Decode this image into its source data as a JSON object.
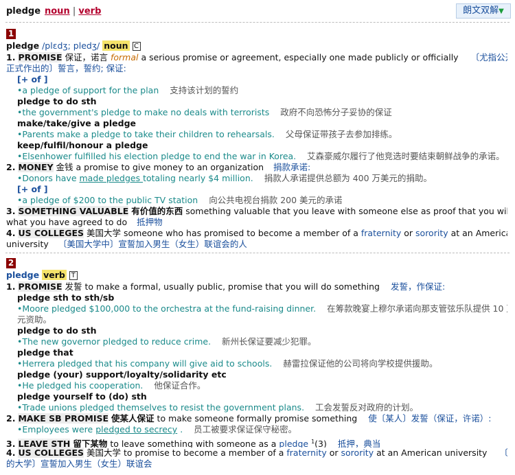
{
  "header": {
    "headword": "pledge",
    "pos_links": [
      "noun",
      "verb"
    ],
    "separator": "|",
    "longman_button": "朗文双解",
    "dropdown_glyph": "▼"
  },
  "entries": [
    {
      "number": "1",
      "headword": "pledge",
      "pron": "/plɛdʒ; pledʒ/",
      "pos": "noun",
      "gram_code": "C",
      "senses": [
        {
          "n": "1.",
          "signpost": "PROMISE",
          "signpost_cn": "保证，诺言",
          "register": "formal",
          "def_line1": "a serious promise or agreement, especially one made publicly or officially",
          "def_cn_line1": "〔尤指公开或",
          "def_cn_line2": "正式作出的〕誓言，誓约; 保证:",
          "items": [
            {
              "pattern": "[+ of ]",
              "ex": "a pledge of support for the plan",
              "ex_cn": "支持该计划的誓约"
            },
            {
              "pattern": "pledge to do sth",
              "ex": "the government's pledge to make no deals with terrorists",
              "ex_cn": "政府不向恐怖分子妥协的保证"
            },
            {
              "pattern": "make/take/give a pledge",
              "ex": "Parents make a pledge to take their children to rehearsals.",
              "ex_cn": "父母保证带孩子去参加排练。"
            },
            {
              "pattern": "keep/fulfil/honour a pledge",
              "ex": "Elsenhower fulfilled his election pledge to end the war in Korea.",
              "ex_cn": "艾森豪威尔履行了他竞选时要结束朝鲜战争的承诺。"
            }
          ]
        },
        {
          "n": "2.",
          "signpost": "MONEY",
          "signpost_cn": "金钱",
          "def": "a promise to give money to an organization",
          "def_cn": "捐款承诺:",
          "items": [
            {
              "ex_pre": "Donors have ",
              "ex_u": "made pledges ",
              "ex_post": "totaling nearly $4 million.",
              "ex_cn": "捐款人承诺提供总额为 400 万美元的捐助。"
            },
            {
              "pattern": "[+ of ]",
              "ex": "a pledge of $200 to the public TV station",
              "ex_cn": "向公共电视台捐款 200 美元的承诺"
            }
          ]
        },
        {
          "n": "3.",
          "signpost": "SOMETHING VALUABLE",
          "signpost_cn": "有价值的东西",
          "def_line1": "something valuable that you leave with someone else as proof that you will do",
          "def_line2": "what you have agreed to do",
          "def_cn": "抵押物"
        },
        {
          "n": "4.",
          "signpost": "US COLLEGES",
          "signpost_cn": "美国大学",
          "def_pre": "someone who has promised to become a member of a ",
          "xref1": "fraternity",
          "def_mid": " or ",
          "xref2": "sorority",
          "def_post": " at an American",
          "def_line2": "university",
          "def_cn": "〔美国大学中〕宣誓加入男生（女生）联谊会的人"
        }
      ]
    },
    {
      "number": "2",
      "headword": "pledge",
      "pos": "verb",
      "gram_code": "T",
      "senses": [
        {
          "n": "1.",
          "signpost": "PROMISE",
          "signpost_cn": "发誓",
          "def": "to make a formal, usually public, promise that you will do something",
          "def_cn": "发誓，作保证:",
          "items": [
            {
              "pattern": "pledge sth to sth/sb",
              "ex": "Moore pledged $100,000 to the orchestra at the fund-raising dinner.",
              "ex_cn": "在筹款晚宴上穆尔承诺向那支管弦乐队提供 10 万美",
              "ex_cn2": "元资助。"
            },
            {
              "pattern": "pledge to do sth",
              "ex": "The new governor pledged to reduce crime.",
              "ex_cn": "新州长保证要减少犯罪。"
            },
            {
              "pattern": "pledge that",
              "ex": "Herrera pledged that his company will give aid to schools.",
              "ex_cn": "赫雷拉保证他的公司将向学校提供援助。"
            },
            {
              "pattern": "pledge (your) support/loyalty/solidarity etc",
              "ex": "He pledged his cooperation.",
              "ex_cn": "他保证合作。"
            },
            {
              "pattern": "pledge yourself to (do) sth",
              "ex": "Trade unions pledged themselves to resist the government plans.",
              "ex_cn": "工会发誓反对政府的计划。"
            }
          ]
        },
        {
          "n": "2.",
          "signpost": "MAKE SB PROMISE",
          "signpost_cn": "使某人保证",
          "def": "to make someone formally promise something",
          "def_cn": "使〔某人〕发誓（保证，许诺）:",
          "items": [
            {
              "ex_pre": "Employees were ",
              "ex_u": "pledged to secrecy",
              "ex_post": " .",
              "ex_cn": "员工被要求保证保守秘密。"
            }
          ]
        },
        {
          "n": "3.",
          "signpost": "LEAVE STH",
          "signpost_cn": "留下某物",
          "def_pre": "to leave something with someone as a ",
          "xref": "pledge",
          "sup": "1",
          "def_post": "(3)",
          "def_cn": "抵押，典当"
        },
        {
          "n": "4.",
          "signpost": "US COLLEGES",
          "signpost_cn": "美国大学",
          "def_pre": "to promise to become a member of a ",
          "xref1": "fraternity",
          "def_mid": " or ",
          "xref2": "sorority",
          "def_post": " at an American university",
          "def_cn_line1": "〔在美国",
          "def_cn_line2": "的大学〕宣誓加入男生（女生）联谊会"
        }
      ]
    }
  ]
}
